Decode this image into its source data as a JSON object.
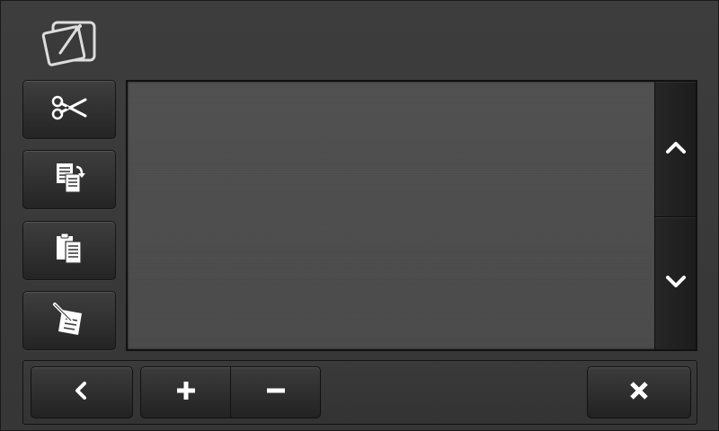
{
  "app": {
    "icon": "edit-window-icon"
  },
  "sidebar": {
    "items": [
      {
        "name": "cut",
        "icon": "scissors-icon"
      },
      {
        "name": "copy",
        "icon": "copy-icon"
      },
      {
        "name": "paste",
        "icon": "clipboard-icon"
      },
      {
        "name": "edit-notes",
        "icon": "pencil-note-icon"
      }
    ]
  },
  "content": {
    "text": ""
  },
  "scrollbar": {
    "up_icon": "chevron-up-icon",
    "down_icon": "chevron-down-icon"
  },
  "toolbar": {
    "back_icon": "chevron-left-icon",
    "zoom_in_icon": "plus-icon",
    "zoom_out_icon": "minus-icon",
    "close_icon": "close-icon"
  },
  "colors": {
    "background": "#3a3a3a",
    "panel": "#4d4d4d",
    "button": "#2e2e2e",
    "icon": "#ffffff"
  }
}
